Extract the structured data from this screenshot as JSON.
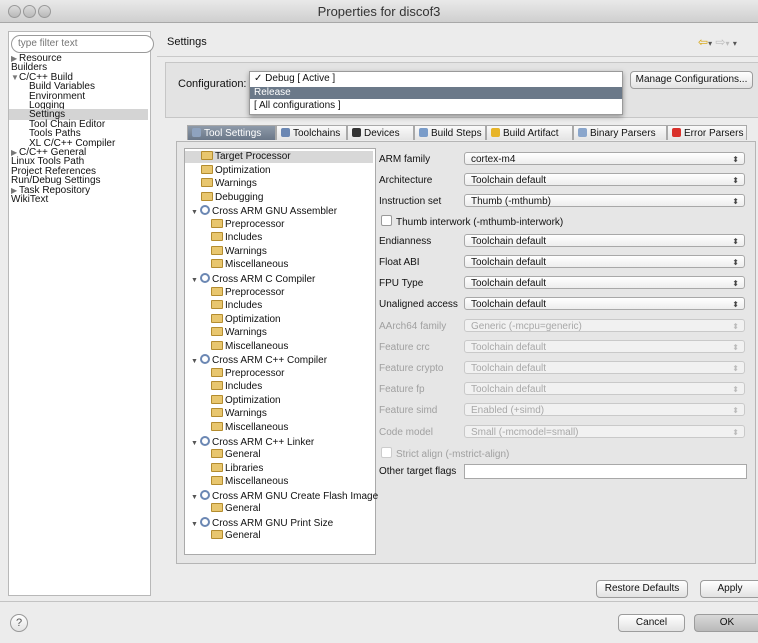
{
  "window": {
    "title": "Properties for discof3"
  },
  "filter": {
    "placeholder": "type filter text"
  },
  "nav_tree": [
    {
      "label": "Resource",
      "indent": 0,
      "arrow": "right"
    },
    {
      "label": "Builders",
      "indent": 0,
      "arrow": ""
    },
    {
      "label": "C/C++ Build",
      "indent": 0,
      "arrow": "down"
    },
    {
      "label": "Build Variables",
      "indent": 1,
      "arrow": ""
    },
    {
      "label": "Environment",
      "indent": 1,
      "arrow": ""
    },
    {
      "label": "Logging",
      "indent": 1,
      "arrow": ""
    },
    {
      "label": "Settings",
      "indent": 1,
      "arrow": "",
      "selected": true
    },
    {
      "label": "Tool Chain Editor",
      "indent": 1,
      "arrow": ""
    },
    {
      "label": "Tools Paths",
      "indent": 1,
      "arrow": ""
    },
    {
      "label": "XL C/C++ Compiler",
      "indent": 1,
      "arrow": ""
    },
    {
      "label": "C/C++ General",
      "indent": 0,
      "arrow": "right"
    },
    {
      "label": "Linux Tools Path",
      "indent": 0,
      "arrow": ""
    },
    {
      "label": "Project References",
      "indent": 0,
      "arrow": ""
    },
    {
      "label": "Run/Debug Settings",
      "indent": 0,
      "arrow": ""
    },
    {
      "label": "Task Repository",
      "indent": 0,
      "arrow": "right"
    },
    {
      "label": "WikiText",
      "indent": 0,
      "arrow": ""
    }
  ],
  "header": {
    "title": "Settings"
  },
  "configuration": {
    "label": "Configuration:",
    "options": [
      "✓ Debug  [ Active ]",
      "Release",
      "[ All configurations ]"
    ],
    "highlighted_index": 1,
    "manage_button": "Manage Configurations..."
  },
  "tabs": [
    {
      "label": "Tool Settings",
      "active": true,
      "color": "#8fa3bf"
    },
    {
      "label": "Toolchains",
      "active": false,
      "color": "#6b87b3"
    },
    {
      "label": "Devices",
      "active": false,
      "color": "#333333"
    },
    {
      "label": "Build Steps",
      "active": false,
      "color": "#7a9cc9"
    },
    {
      "label": "Build Artifact",
      "active": false,
      "color": "#e7b428"
    },
    {
      "label": "Binary Parsers",
      "active": false,
      "color": "#8aa6cc"
    },
    {
      "label": "Error Parsers",
      "active": false,
      "color": "#d9302a"
    }
  ],
  "tool_tree": [
    {
      "label": "Target Processor",
      "level": 1,
      "icon": "folder",
      "selected": true
    },
    {
      "label": "Optimization",
      "level": 1,
      "icon": "folder"
    },
    {
      "label": "Warnings",
      "level": 1,
      "icon": "folder"
    },
    {
      "label": "Debugging",
      "level": 1,
      "icon": "folder"
    },
    {
      "label": "Cross ARM GNU Assembler",
      "level": 0,
      "icon": "gear",
      "expanded": true
    },
    {
      "label": "Preprocessor",
      "level": 2,
      "icon": "folder"
    },
    {
      "label": "Includes",
      "level": 2,
      "icon": "folder"
    },
    {
      "label": "Warnings",
      "level": 2,
      "icon": "folder"
    },
    {
      "label": "Miscellaneous",
      "level": 2,
      "icon": "folder"
    },
    {
      "label": "Cross ARM C Compiler",
      "level": 0,
      "icon": "gear",
      "expanded": true
    },
    {
      "label": "Preprocessor",
      "level": 2,
      "icon": "folder"
    },
    {
      "label": "Includes",
      "level": 2,
      "icon": "folder"
    },
    {
      "label": "Optimization",
      "level": 2,
      "icon": "folder"
    },
    {
      "label": "Warnings",
      "level": 2,
      "icon": "folder"
    },
    {
      "label": "Miscellaneous",
      "level": 2,
      "icon": "folder"
    },
    {
      "label": "Cross ARM C++ Compiler",
      "level": 0,
      "icon": "gear",
      "expanded": true
    },
    {
      "label": "Preprocessor",
      "level": 2,
      "icon": "folder"
    },
    {
      "label": "Includes",
      "level": 2,
      "icon": "folder"
    },
    {
      "label": "Optimization",
      "level": 2,
      "icon": "folder"
    },
    {
      "label": "Warnings",
      "level": 2,
      "icon": "folder"
    },
    {
      "label": "Miscellaneous",
      "level": 2,
      "icon": "folder"
    },
    {
      "label": "Cross ARM C++ Linker",
      "level": 0,
      "icon": "gear",
      "expanded": true
    },
    {
      "label": "General",
      "level": 2,
      "icon": "folder"
    },
    {
      "label": "Libraries",
      "level": 2,
      "icon": "folder"
    },
    {
      "label": "Miscellaneous",
      "level": 2,
      "icon": "folder"
    },
    {
      "label": "Cross ARM GNU Create Flash Image",
      "level": 0,
      "icon": "gear",
      "expanded": true
    },
    {
      "label": "General",
      "level": 2,
      "icon": "folder"
    },
    {
      "label": "Cross ARM GNU Print Size",
      "level": 0,
      "icon": "gear",
      "expanded": true
    },
    {
      "label": "General",
      "level": 2,
      "icon": "folder"
    }
  ],
  "fields": [
    {
      "kind": "select",
      "label": "ARM family",
      "value": "cortex-m4",
      "disabled": false
    },
    {
      "kind": "select",
      "label": "Architecture",
      "value": "Toolchain default",
      "disabled": false
    },
    {
      "kind": "select",
      "label": "Instruction set",
      "value": "Thumb (-mthumb)",
      "disabled": false
    },
    {
      "kind": "checkbox",
      "label": "Thumb interwork (-mthumb-interwork)",
      "disabled": false
    },
    {
      "kind": "select",
      "label": "Endianness",
      "value": "Toolchain default",
      "disabled": false
    },
    {
      "kind": "select",
      "label": "Float ABI",
      "value": "Toolchain default",
      "disabled": false
    },
    {
      "kind": "select",
      "label": "FPU Type",
      "value": "Toolchain default",
      "disabled": false
    },
    {
      "kind": "select",
      "label": "Unaligned access",
      "value": "Toolchain default",
      "disabled": false
    },
    {
      "kind": "select",
      "label": "AArch64 family",
      "value": "Generic (-mcpu=generic)",
      "disabled": true
    },
    {
      "kind": "select",
      "label": "Feature crc",
      "value": "Toolchain default",
      "disabled": true
    },
    {
      "kind": "select",
      "label": "Feature crypto",
      "value": "Toolchain default",
      "disabled": true
    },
    {
      "kind": "select",
      "label": "Feature fp",
      "value": "Toolchain default",
      "disabled": true
    },
    {
      "kind": "select",
      "label": "Feature simd",
      "value": "Enabled (+simd)",
      "disabled": true
    },
    {
      "kind": "select",
      "label": "Code model",
      "value": "Small (-mcmodel=small)",
      "disabled": true
    },
    {
      "kind": "checkbox",
      "label": "Strict align (-mstrict-align)",
      "disabled": true
    },
    {
      "kind": "text",
      "label": "Other target flags",
      "value": "",
      "disabled": false
    }
  ],
  "buttons": {
    "restore_defaults": "Restore Defaults",
    "apply": "Apply",
    "cancel": "Cancel",
    "ok": "OK",
    "help": "?"
  }
}
